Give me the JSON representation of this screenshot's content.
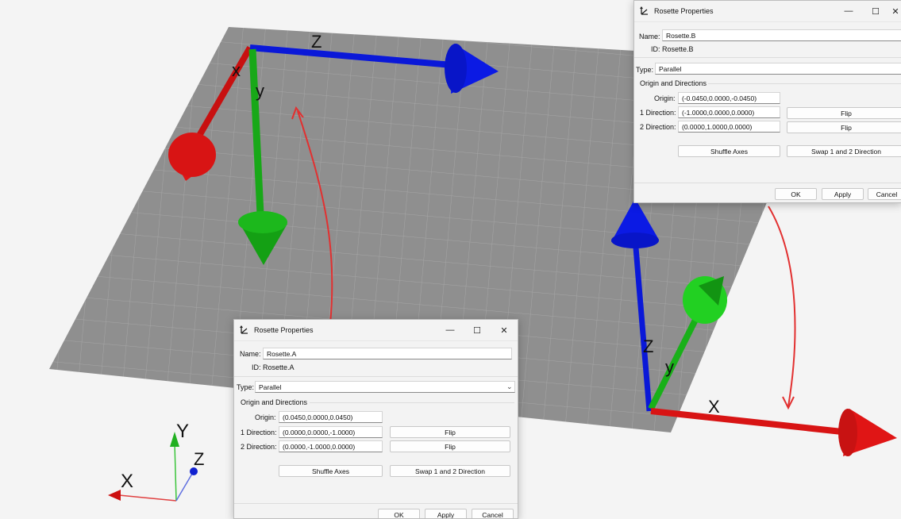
{
  "scene": {
    "axis_labels": {
      "a_x": "x",
      "a_y": "y",
      "a_z": "Z",
      "b_x": "X",
      "b_y": "y",
      "b_z": "Z",
      "tri_x": "X",
      "tri_y": "Y",
      "tri_z": "Z"
    },
    "colors": {
      "x_axis": "#e01010",
      "y_axis": "#19b019",
      "z_axis": "#0a18d8",
      "annotation": "#e23030",
      "grid_plane": "#8f8f8f"
    }
  },
  "dialog_a": {
    "title": "Rosette Properties",
    "name_label": "Name:",
    "name_value": "Rosette.A",
    "id_label": "ID:",
    "id_value": "Rosette.A",
    "type_label": "Type:",
    "type_value": "Parallel",
    "group_title": "Origin and Directions",
    "origin_label": "Origin:",
    "origin_value": "(0.0450,0.0000,0.0450)",
    "dir1_label": "1 Direction:",
    "dir1_value": "(0.0000,0.0000,-1.0000)",
    "dir2_label": "2 Direction:",
    "dir2_value": "(0.0000,-1.0000,0.0000)",
    "flip1_label": "Flip",
    "flip2_label": "Flip",
    "shuffle_label": "Shuffle Axes",
    "swap_label": "Swap 1 and 2 Direction",
    "ok_label": "OK",
    "apply_label": "Apply",
    "cancel_label": "Cancel"
  },
  "dialog_b": {
    "title": "Rosette Properties",
    "name_label": "Name:",
    "name_value": "Rosette.B",
    "id_label": "ID:",
    "id_value": "Rosette.B",
    "type_label": "Type:",
    "type_value": "Parallel",
    "group_title": "Origin and Directions",
    "origin_label": "Origin:",
    "origin_value": "(-0.0450,0.0000,-0.0450)",
    "dir1_label": "1 Direction:",
    "dir1_value": "(-1.0000,0.0000,0.0000)",
    "dir2_label": "2 Direction:",
    "dir2_value": "(0.0000,1.0000,0.0000)",
    "flip1_label": "Flip",
    "flip2_label": "Flip",
    "shuffle_label": "Shuffle Axes",
    "swap_label": "Swap 1 and 2 Direction",
    "ok_label": "OK",
    "apply_label": "Apply",
    "cancel_label": "Cancel"
  },
  "window_controls": {
    "minimize": "—",
    "maximize": "☐",
    "close": "✕"
  }
}
